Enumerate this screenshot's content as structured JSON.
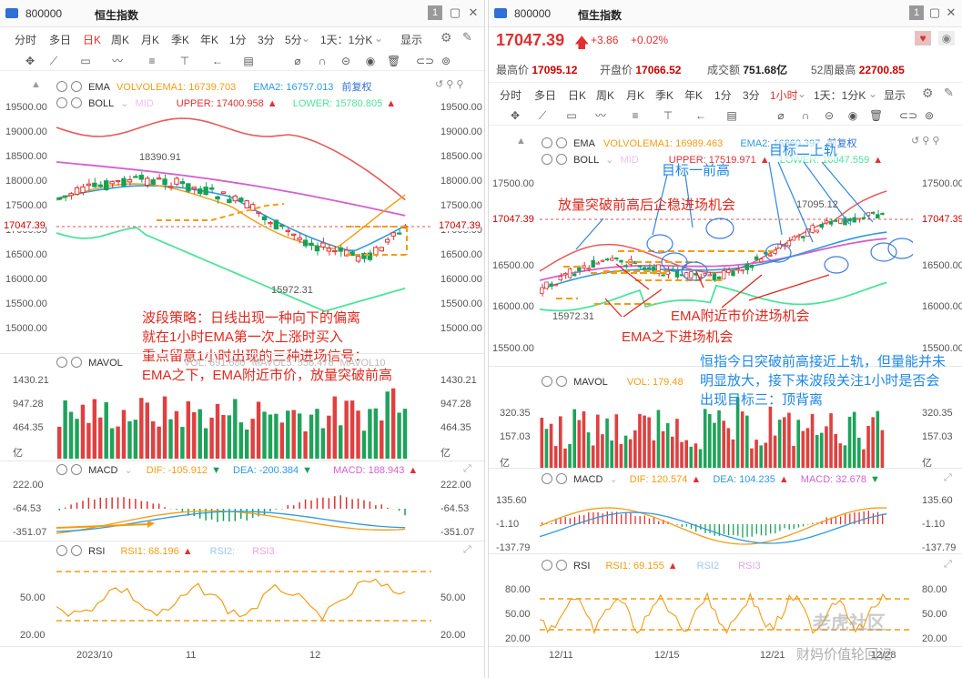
{
  "colors": {
    "up": "#e03030",
    "down": "#17a057",
    "ema1": "#f39c12",
    "ema2": "#2d9ae0",
    "upper": "#e85a5a",
    "mid": "#d55fd0",
    "lower": "#4de39a",
    "annot": "#e0281e",
    "annot_blue": "#1e88e5"
  },
  "left": {
    "title": {
      "code": "800000",
      "name": "恒生指数",
      "badge": "1"
    },
    "periods": [
      "分时",
      "多日",
      "日K",
      "周K",
      "月K",
      "季K",
      "年K",
      "1分",
      "3分",
      "5分"
    ],
    "selected_period": "日K",
    "range": "1天：1分K",
    "display": "显示",
    "ema": {
      "label": "EMA",
      "ema1": "VOLVOLEMA1: 16739.703",
      "ema2": "EMA2: 16757.013",
      "fq": "前复权"
    },
    "boll": {
      "label": "BOLL",
      "mid": "MID",
      "upper": "UPPER: 17400.958",
      "lower": "LOWER: 15780.805"
    },
    "price_axis": [
      "19500.00",
      "19000.00",
      "18500.00",
      "18000.00",
      "17500.00",
      "17000.00",
      "16500.00",
      "16000.00",
      "15500.00",
      "15000.00"
    ],
    "current_price": "17047.39",
    "high_mark": "18390.91",
    "low_mark": "15972.31",
    "mavol": {
      "label": "MAVOL",
      "vol": "VOL: 691.680",
      "mavol5": "MAVOL5: 556.478",
      "mavol10": "MAVOL10"
    },
    "vol_axis": [
      "1430.21",
      "947.28",
      "464.35",
      "亿"
    ],
    "macd": {
      "label": "MACD",
      "dif": "DIF: -105.912",
      "dea": "DEA: -200.384",
      "macd": "MACD: 188.943"
    },
    "macd_axis": [
      "222.00",
      "-64.53",
      "-351.07"
    ],
    "rsi": {
      "label": "RSI",
      "rsi1": "RSI1: 68.196",
      "rsi2": "RSI2:",
      "rsi3": "RSI3"
    },
    "rsi_axis": [
      "50.00",
      "20.00"
    ],
    "date_axis": [
      "2023/10",
      "11",
      "12"
    ],
    "annotation": [
      "波段策略：日线出现一种向下的偏离",
      "就在1小时EMA第一次上涨时买入",
      "重点留意1小时出现的三种进场信号：",
      "EMA之下，EMA附近市价，放量突破前高"
    ]
  },
  "right": {
    "title": {
      "code": "800000",
      "name": "恒生指数",
      "badge": "1"
    },
    "price": "17047.39",
    "change": "+3.86",
    "change_pct": "+0.02%",
    "stats": {
      "high_label": "最高价",
      "high": "17095.12",
      "open_label": "开盘价",
      "open": "17066.52",
      "amount_label": "成交额",
      "amount": "751.68亿",
      "w52_label": "52周最高",
      "w52": "22700.85"
    },
    "periods": [
      "分时",
      "多日",
      "日K",
      "周K",
      "月K",
      "季K",
      "年K",
      "1分",
      "3分",
      "1小时"
    ],
    "selected_period": "1小时",
    "range": "1天：1分K",
    "display": "显示",
    "ema": {
      "label": "EMA",
      "ema1": "VOLVOLEMA1: 16989.463",
      "ema2": "EMA2: 16860.397",
      "fq": "前复权"
    },
    "boll": {
      "label": "BOLL",
      "mid": "MID",
      "upper": "UPPER: 17519.971",
      "lower": "LOWER: 16047.559"
    },
    "price_axis": [
      "17500.00",
      "17047.39",
      "16500.00",
      "16000.00",
      "15500.00"
    ],
    "current_price": "17047.39",
    "high_mark": "17095.12",
    "low_mark": "15972.31",
    "mavol": {
      "label": "MAVOL",
      "vol": "VOL: 179.48"
    },
    "vol_axis": [
      "320.35",
      "157.03",
      "亿"
    ],
    "macd": {
      "label": "MACD",
      "dif": "DIF: 120.574",
      "dea": "DEA: 104.235",
      "macd": "MACD: 32.678"
    },
    "macd_axis": [
      "135.60",
      "-1.10",
      "-137.79"
    ],
    "rsi": {
      "label": "RSI",
      "rsi1": "RSI1: 69.155",
      "rsi2": "RSI2",
      "rsi3": "RSI3"
    },
    "rsi_axis": [
      "80.00",
      "50.00",
      "20.00"
    ],
    "date_axis": [
      "12/11",
      "12/15",
      "12/21",
      "12/28"
    ],
    "annotations": {
      "target_prev_high": "目标一前高",
      "target_upper": "目标二上轨",
      "breakout": "放量突破前高后企稳进场机会",
      "near_ema": "EMA附近市价进场机会",
      "below_ema": "EMA之下进场机会",
      "summary": [
        "恒指今日突破前高接近上轨，但量能并未",
        "明显放大，接下来波段关注1小时是否会",
        "出现目标三：顶背离"
      ]
    },
    "watermark": "老虎社区",
    "watermark2": "财妈价值轮回记"
  }
}
